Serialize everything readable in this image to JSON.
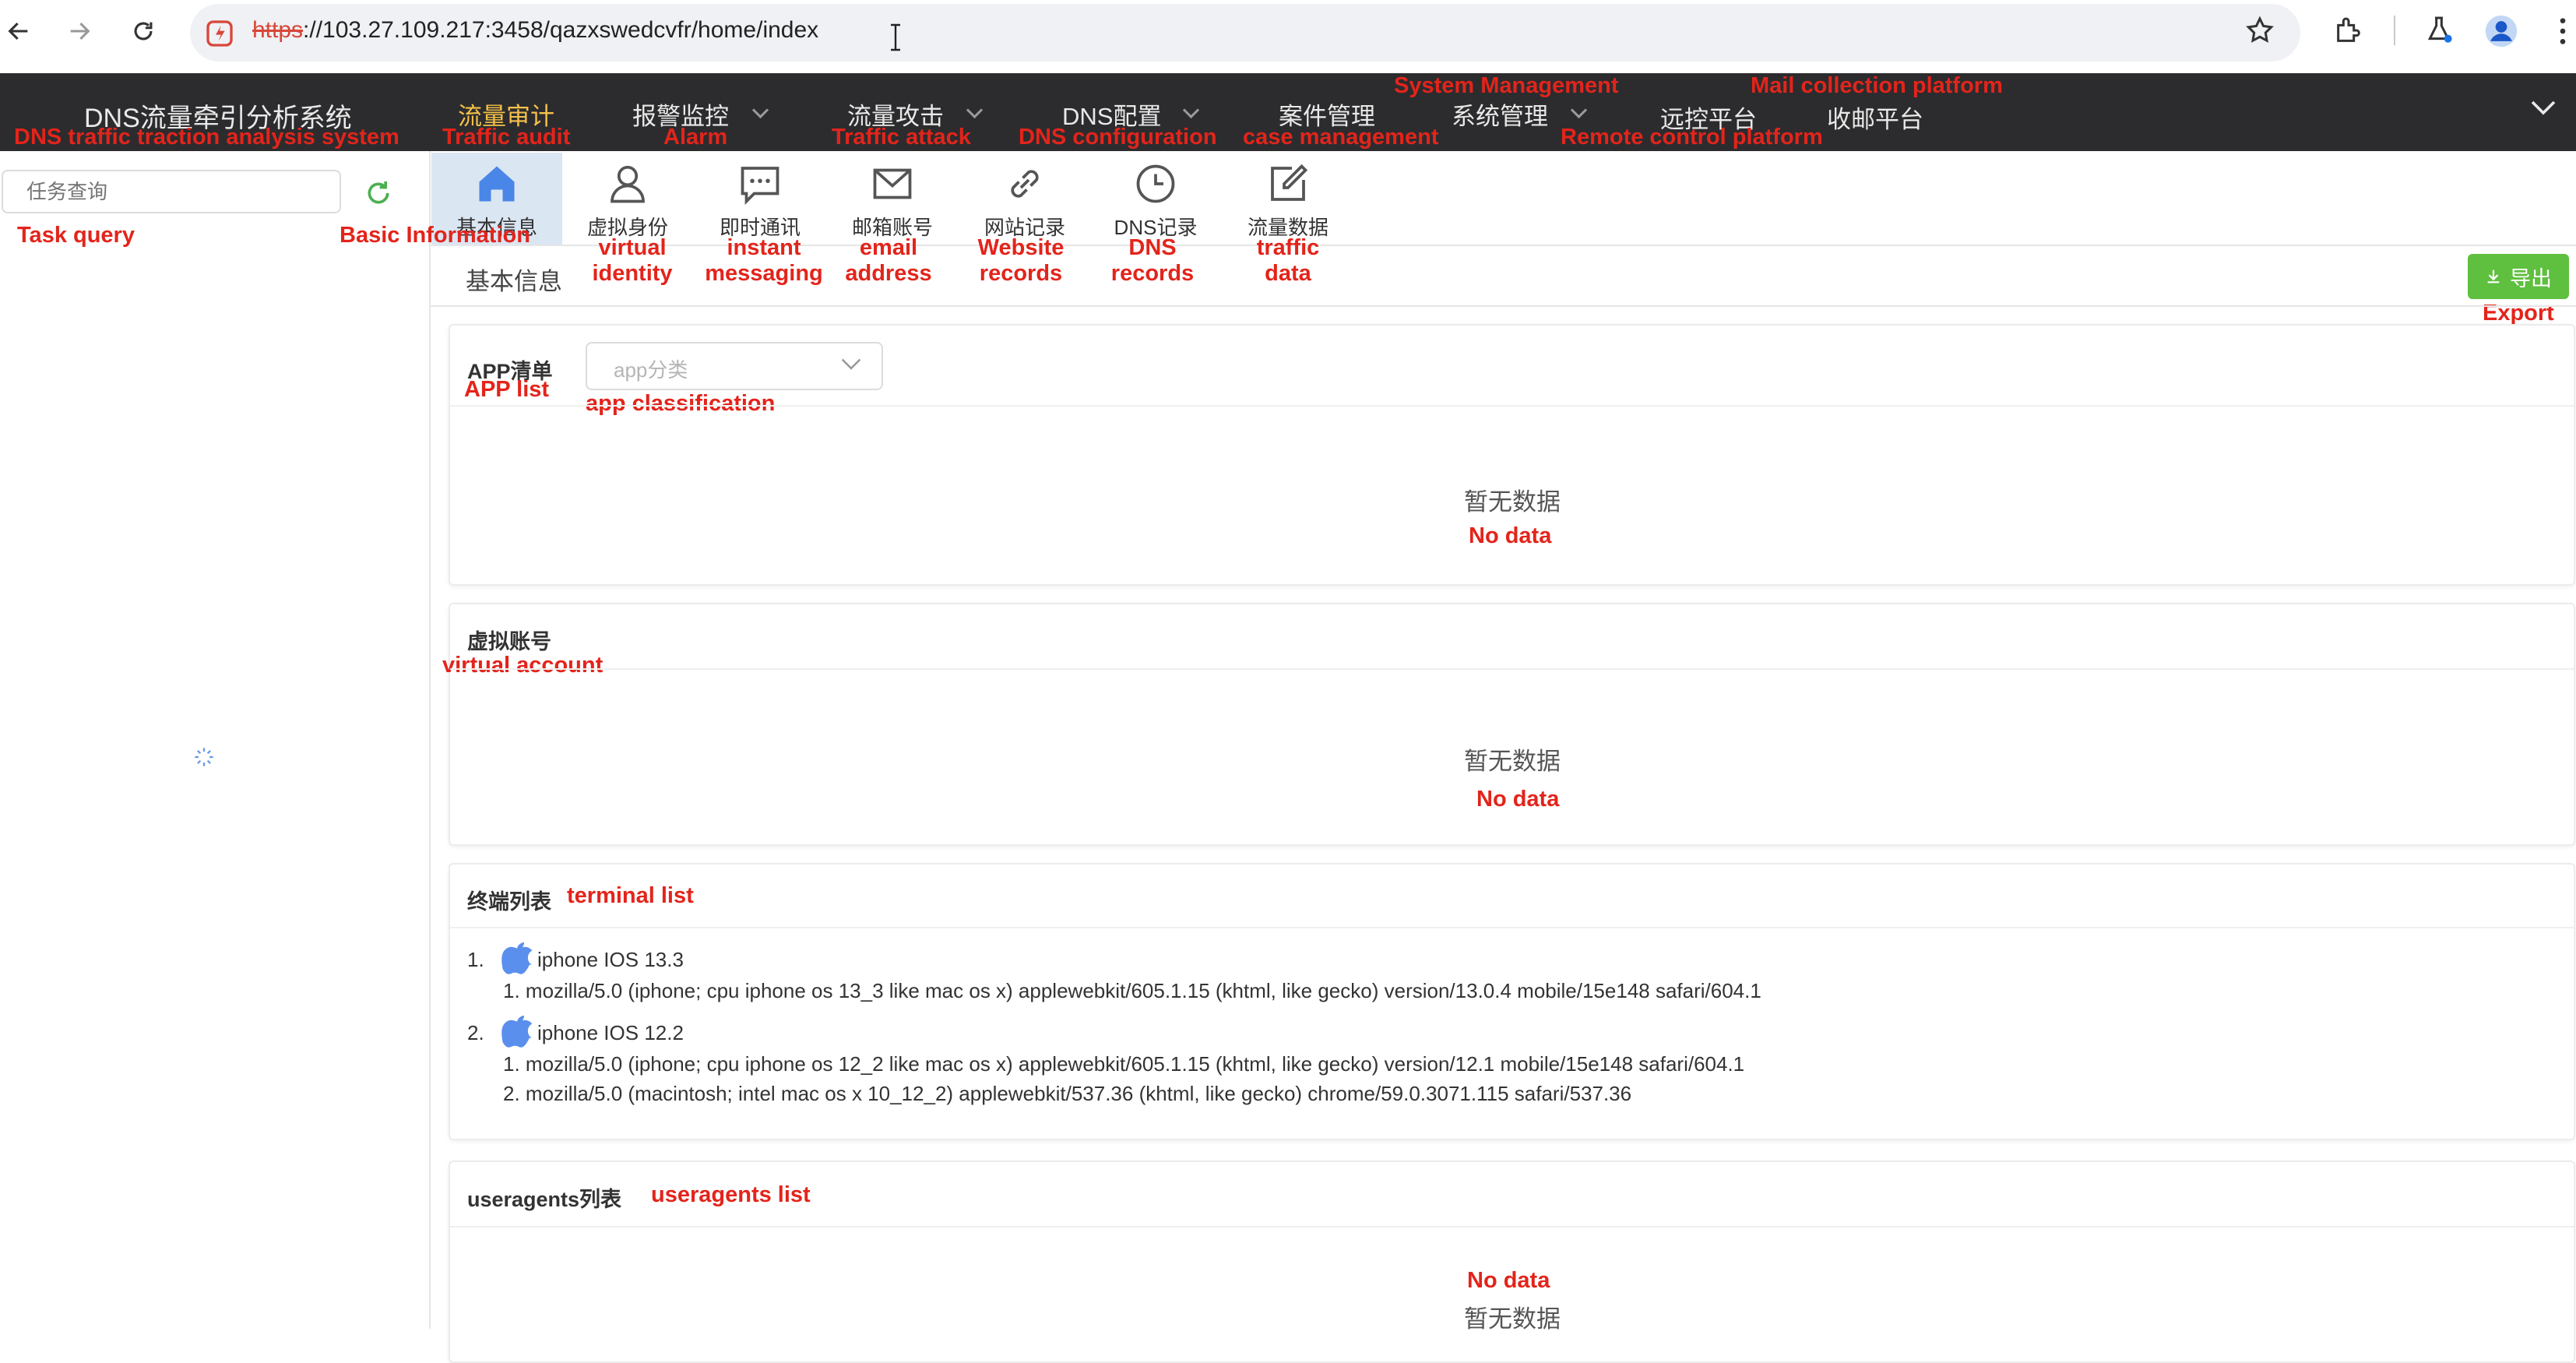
{
  "browser": {
    "url_https": "https",
    "url_rest": "://103.27.109.217:3458/qazxswedcvfr/home/index"
  },
  "app": {
    "title": "DNS流量牵引分析系统",
    "title_en": "DNS traffic traction analysis system",
    "nav": [
      {
        "label": "流量审计",
        "en": "Traffic audit",
        "active": true
      },
      {
        "label": "报警监控",
        "en": "Alarm"
      },
      {
        "label": "流量攻击",
        "en": "Traffic attack"
      },
      {
        "label": "DNS配置",
        "en": "DNS configuration"
      },
      {
        "label": "案件管理",
        "en": "case management"
      },
      {
        "label": "系统管理",
        "en": "System Management"
      },
      {
        "label": "远控平台",
        "en": "Remote control platform"
      },
      {
        "label": "收邮平台",
        "en": "Mail collection platform"
      }
    ]
  },
  "sidebar": {
    "search_placeholder": "任务查询",
    "search_en": "Task query"
  },
  "tabs": [
    {
      "label": "基本信息",
      "en": "Basic Information",
      "icon": "home-icon",
      "active": true
    },
    {
      "label": "虚拟身份",
      "en": "virtual identity",
      "icon": "user-icon"
    },
    {
      "label": "即时通讯",
      "en": "instant messaging",
      "icon": "chat-icon"
    },
    {
      "label": "邮箱账号",
      "en": "email address",
      "icon": "mail-icon"
    },
    {
      "label": "网站记录",
      "en": "Website records",
      "icon": "link-icon"
    },
    {
      "label": "DNS记录",
      "en": "DNS records",
      "icon": "clock-icon"
    },
    {
      "label": "流量数据",
      "en": "traffic data",
      "icon": "edit-icon"
    }
  ],
  "section": {
    "title": "基本信息",
    "export_label": "导出",
    "export_en": "Export"
  },
  "app_list": {
    "title": "APP清单",
    "title_en": "APP list",
    "select_placeholder": "app分类",
    "select_en": "app classification",
    "empty": "暂无数据",
    "empty_en": "No data"
  },
  "virtual_account": {
    "title": "虚拟账号",
    "title_en": "virtual account",
    "empty": "暂无数据",
    "empty_en": "No data"
  },
  "terminal_list": {
    "title": "终端列表",
    "title_en": "terminal list",
    "items": [
      {
        "num": "1.",
        "name": "iphone IOS 13.3",
        "agents": [
          "1. mozilla/5.0 (iphone; cpu iphone os 13_3 like mac os x) applewebkit/605.1.15 (khtml, like gecko) version/13.0.4 mobile/15e148 safari/604.1"
        ]
      },
      {
        "num": "2.",
        "name": "iphone IOS 12.2",
        "agents": [
          "1. mozilla/5.0 (iphone; cpu iphone os 12_2 like mac os x) applewebkit/605.1.15 (khtml, like gecko) version/12.1 mobile/15e148 safari/604.1",
          "2. mozilla/5.0 (macintosh; intel mac os x 10_12_2) applewebkit/537.36 (khtml, like gecko) chrome/59.0.3071.115 safari/537.36"
        ]
      }
    ]
  },
  "useragents": {
    "title": "useragents列表",
    "title_en": "useragents list",
    "empty": "暂无数据",
    "empty_en": "No data"
  },
  "colors": {
    "header_bg": "#2c2c2e",
    "active_nav": "#f5c04a",
    "annotation": "#e3241b",
    "export_btn": "#5fbf3f",
    "tab_active": "#dbe6f3",
    "icon_blue": "#4a86e8"
  }
}
